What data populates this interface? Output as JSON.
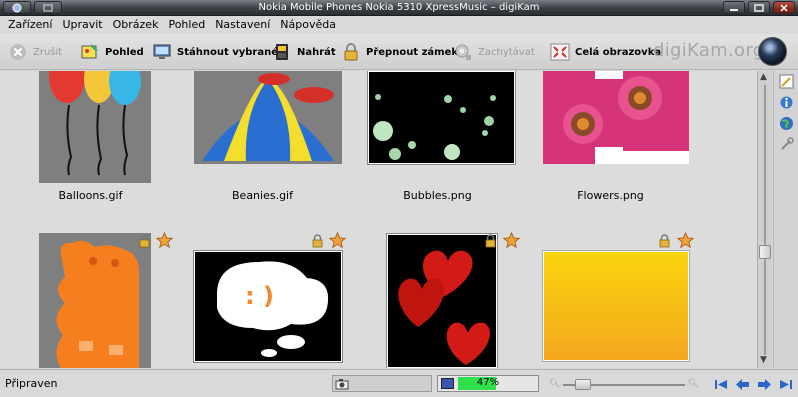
{
  "window": {
    "title": "Nokia Mobile Phones  Nokia 5310 XpressMusic – digiKam"
  },
  "menu": [
    "Zařízení",
    "Upravit",
    "Obrázek",
    "Pohled",
    "Nastavení",
    "Nápověda"
  ],
  "toolbar": {
    "cancel": "Zrušit",
    "view": "Pohled",
    "download_selected": "Stáhnout vybrané",
    "upload": "Nahrát",
    "toggle_lock": "Přepnout zámek",
    "capture": "Zachytávat",
    "fullscreen": "Celá obrazovka",
    "brand": "digiKam.org"
  },
  "thumbnails": [
    {
      "name": "Balloons.gif",
      "locked": false,
      "starred": false
    },
    {
      "name": "Beanies.gif",
      "locked": false,
      "starred": false
    },
    {
      "name": "Bubbles.png",
      "locked": false,
      "starred": false
    },
    {
      "name": "Flowers.png",
      "locked": false,
      "starred": false
    },
    {
      "name": "",
      "locked": true,
      "starred": true
    },
    {
      "name": "",
      "locked": true,
      "starred": true
    },
    {
      "name": "",
      "locked": true,
      "starred": true
    },
    {
      "name": "",
      "locked": true,
      "starred": true
    }
  ],
  "status": {
    "text": "Připraven",
    "progress_label": "47%",
    "progress_value": 47
  },
  "colors": {
    "progress_fill": "#2fe04a",
    "star": "#f0a23a",
    "lock": "#e0b341"
  }
}
